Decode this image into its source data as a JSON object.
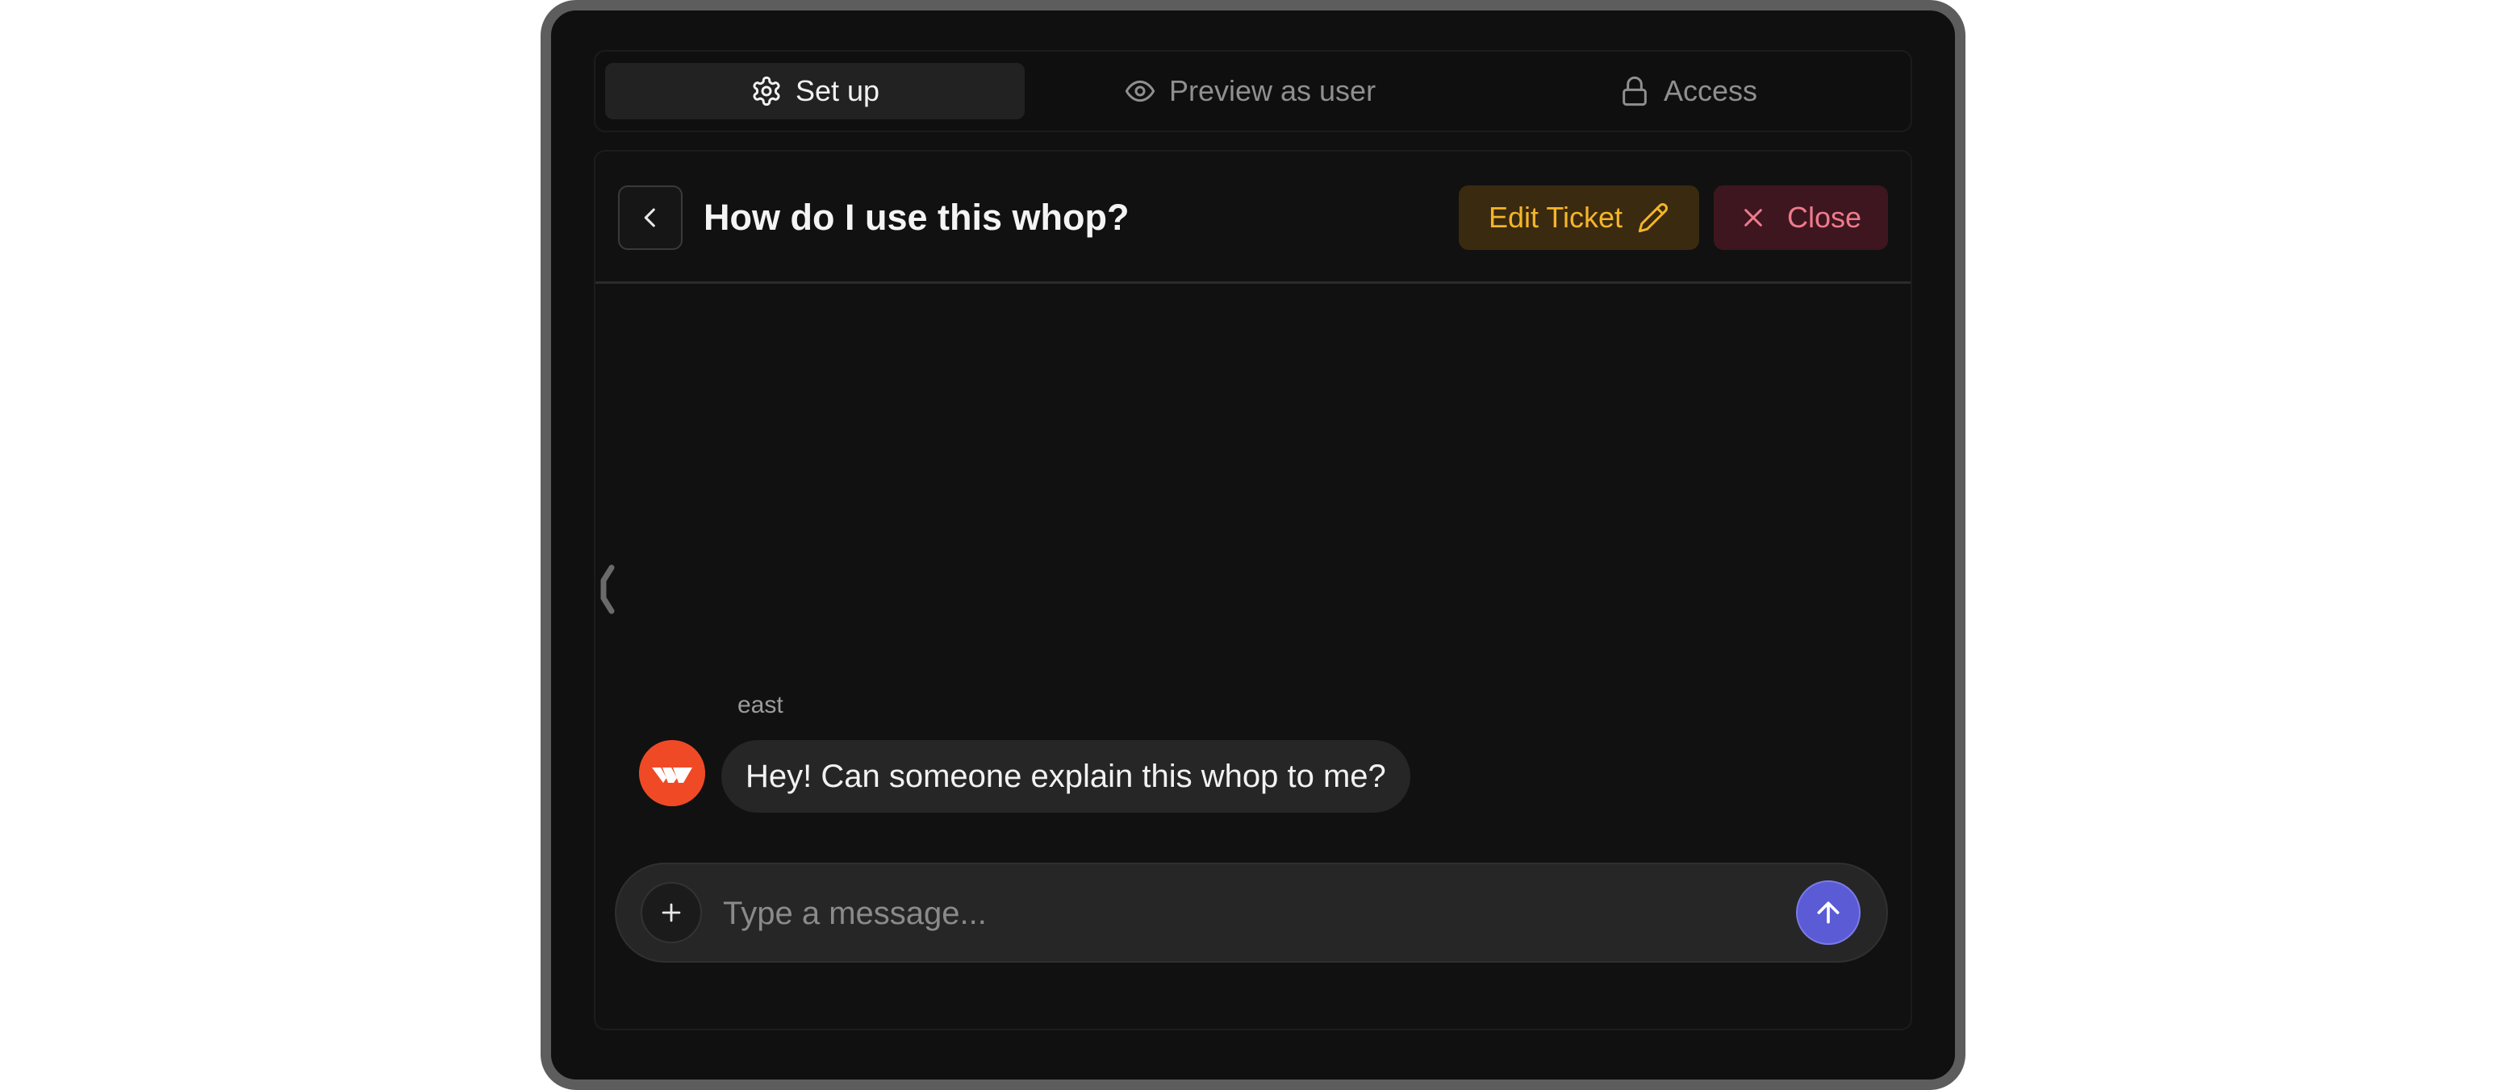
{
  "tabs": {
    "setup": {
      "label": "Set up",
      "icon": "gear-icon",
      "active": true
    },
    "preview": {
      "label": "Preview as user",
      "icon": "eye-icon",
      "active": false
    },
    "access": {
      "label": "Access",
      "icon": "lock-icon",
      "active": false
    }
  },
  "ticket": {
    "title": "How do I use this whop?",
    "edit_label": "Edit Ticket",
    "close_label": "Close"
  },
  "messages": [
    {
      "sender": "east",
      "text": "Hey! Can someone explain this whop to me?",
      "avatar": "whop-logo-icon"
    }
  ],
  "composer": {
    "placeholder": "Type a message...",
    "value": ""
  },
  "colors": {
    "background": "#101010",
    "frame": "#5d5d5d",
    "edit_accent": "#f5b52a",
    "close_accent": "#ef7b8a",
    "send_accent": "#5b5bd6",
    "avatar": "#ef4a25"
  }
}
